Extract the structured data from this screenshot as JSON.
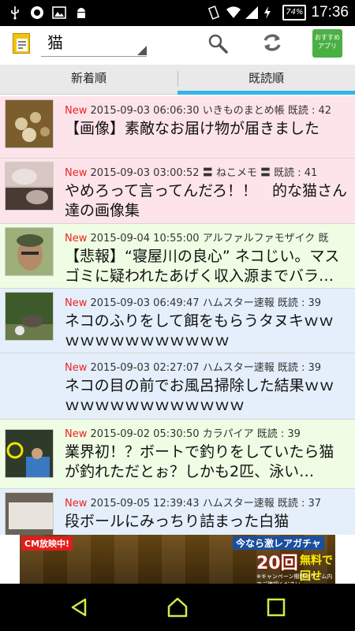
{
  "status_bar": {
    "battery": "74%",
    "time": "17:36"
  },
  "toolbar": {
    "category": "猫",
    "recommend_label_line1": "おすすめ",
    "recommend_label_line2": "アプリ"
  },
  "tabs": [
    {
      "label": "新着順",
      "active": false
    },
    {
      "label": "既読順",
      "active": true
    }
  ],
  "articles": [
    {
      "new": "New",
      "meta": "2015-09-03 06:06:30 いきものまとめ帳 既読 : 42",
      "title": "【画像】素敵なお届け物が届きました",
      "bg": "#fde4ea"
    },
    {
      "new": "New",
      "meta": "2015-09-03 03:00:52 〓 ねこメモ 〓 既読 : 41",
      "title": "やめろって言ってんだろ！！　的な猫さん達の画像集",
      "bg": "#fde4ea"
    },
    {
      "new": "New",
      "meta": "2015-09-04 10:55:00 アルファルファモザイク 既",
      "title": "【悲報】“寝屋川の良心” ネコじい。マスゴミに疑われたあげく収入源までバラ…",
      "bg": "#effde4"
    },
    {
      "new": "New",
      "meta": "2015-09-03 06:49:47 ハムスター速報 既読 : 39",
      "title": "ネコのふりをして餌をもらうタヌキｗｗｗｗｗｗｗｗｗｗｗｗｗ",
      "bg": "#e4effb"
    },
    {
      "new": "New",
      "meta": "2015-09-03 02:27:07 ハムスター速報 既読 : 39",
      "title": "ネコの目の前でお風呂掃除した結果ｗｗｗｗｗｗｗｗｗｗｗｗｗｗ",
      "bg": "#e4effb"
    },
    {
      "new": "New",
      "meta": "2015-09-02 05:30:50 カラパイア 既読 : 39",
      "title": "業界初！？ボートで釣りをしていたら猫が釣れただとぉ？しかも2匹、泳い…",
      "bg": "#effde4"
    },
    {
      "new": "New",
      "meta": "2015-09-05 12:39:43 ハムスター速報 既読 : 37",
      "title": "段ボールにみっちり詰まった白猫",
      "bg": "#e4effb"
    }
  ],
  "ad": {
    "cm_badge": "CM放映中!",
    "line1": "今なら激レアガチャ",
    "count": "20回",
    "free": "無料で回せる!!",
    "note": "※キャンペーン期間はゲーム内でご確認ください"
  }
}
